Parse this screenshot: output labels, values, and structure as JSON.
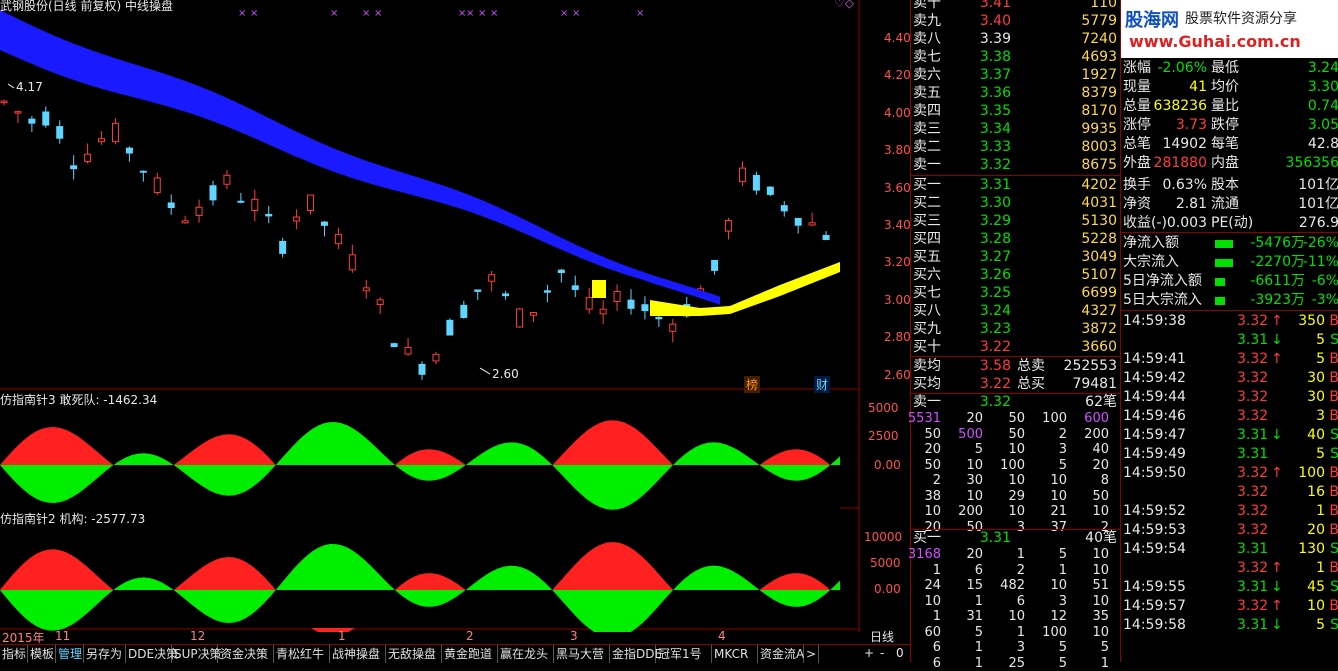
{
  "chart": {
    "title": "武钢股份(日线 前复权) 中线操盘",
    "hi_label": "4.17",
    "lo_label": "2.60",
    "price_ticks": [
      "4.40",
      "4.20",
      "4.00",
      "3.80",
      "3.60",
      "3.40",
      "3.20",
      "3.00",
      "2.80",
      "2.60"
    ],
    "markers": {
      "bang": "榜",
      "cai": "财"
    },
    "ind1_title": "仿指南针3 敢死队: -1462.34",
    "ind1_ticks": [
      "5000",
      "2500",
      "0.00"
    ],
    "ind2_title": "仿指南针2 机构: -2577.73",
    "ind2_ticks": [
      "10000",
      "5000",
      "0.00"
    ],
    "date_labels": [
      "2015年",
      "11",
      "12",
      "1",
      "2",
      "3",
      "4"
    ],
    "period_label": "日线"
  },
  "bottom_tabs": [
    "指标",
    "模板",
    "管理",
    "另存为",
    "DDE决策",
    "SUP决策",
    "资金决策",
    "青松红牛",
    "战神操盘",
    "无敌操盘",
    "黄金跑道",
    "赢在龙头",
    "黑马大营",
    "金指DDE",
    "冠军1号",
    "MKCR",
    "资金流A"
  ],
  "bottom_nav": [
    "<",
    ">",
    "+",
    "-",
    "0"
  ],
  "quote": {
    "sell": [
      {
        "label": "卖十",
        "price": "3.41",
        "vol": "110"
      },
      {
        "label": "卖九",
        "price": "3.40",
        "vol": "5779"
      },
      {
        "label": "卖八",
        "price": "3.39",
        "vol": "7240"
      },
      {
        "label": "卖七",
        "price": "3.38",
        "vol": "4693"
      },
      {
        "label": "卖六",
        "price": "3.37",
        "vol": "1927"
      },
      {
        "label": "卖五",
        "price": "3.36",
        "vol": "8379"
      },
      {
        "label": "卖四",
        "price": "3.35",
        "vol": "8170"
      },
      {
        "label": "卖三",
        "price": "3.34",
        "vol": "9935"
      },
      {
        "label": "卖二",
        "price": "3.33",
        "vol": "8003"
      },
      {
        "label": "卖一",
        "price": "3.32",
        "vol": "8675"
      }
    ],
    "buy": [
      {
        "label": "买一",
        "price": "3.31",
        "vol": "4202"
      },
      {
        "label": "买二",
        "price": "3.30",
        "vol": "4031"
      },
      {
        "label": "买三",
        "price": "3.29",
        "vol": "5130"
      },
      {
        "label": "买四",
        "price": "3.28",
        "vol": "5228"
      },
      {
        "label": "买五",
        "price": "3.27",
        "vol": "3049"
      },
      {
        "label": "买六",
        "price": "3.26",
        "vol": "5107"
      },
      {
        "label": "买七",
        "price": "3.25",
        "vol": "6699"
      },
      {
        "label": "买八",
        "price": "3.24",
        "vol": "4327"
      },
      {
        "label": "买九",
        "price": "3.23",
        "vol": "3872"
      },
      {
        "label": "买十",
        "price": "3.22",
        "vol": "3660"
      }
    ],
    "avg_sell": {
      "label": "卖均",
      "price": "3.58",
      "tlabel": "总卖",
      "total": "252553"
    },
    "avg_buy": {
      "label": "买均",
      "price": "3.22",
      "tlabel": "总买",
      "total": "79481"
    },
    "sell1_queue": {
      "label": "卖一",
      "price": "3.32",
      "count": "62笔",
      "rows": [
        [
          "5531",
          "20",
          "50",
          "100",
          "600"
        ],
        [
          "50",
          "500",
          "50",
          "2",
          "200"
        ],
        [
          "20",
          "5",
          "10",
          "3",
          "40"
        ],
        [
          "50",
          "10",
          "100",
          "5",
          "20"
        ],
        [
          "2",
          "30",
          "10",
          "10",
          "8"
        ],
        [
          "38",
          "10",
          "29",
          "10",
          "50"
        ],
        [
          "10",
          "200",
          "10",
          "21",
          "10"
        ],
        [
          "20",
          "50",
          "3",
          "37",
          "2"
        ]
      ]
    },
    "buy1_queue": {
      "label": "买一",
      "price": "3.31",
      "count": "40笔",
      "rows": [
        [
          "3168",
          "20",
          "1",
          "5",
          "10"
        ],
        [
          "1",
          "6",
          "2",
          "1",
          "10"
        ],
        [
          "24",
          "15",
          "482",
          "10",
          "51"
        ],
        [
          "10",
          "1",
          "6",
          "3",
          "10"
        ],
        [
          "1",
          "31",
          "10",
          "12",
          "35"
        ],
        [
          "60",
          "5",
          "1",
          "100",
          "10"
        ],
        [
          "6",
          "1",
          "3",
          "5",
          "5"
        ],
        [
          "6",
          "1",
          "25",
          "5",
          "1"
        ]
      ]
    }
  },
  "logo": {
    "name": "股海网",
    "slogan": "股票软件资源分享",
    "url": "www.Guhai.com.cn"
  },
  "info": {
    "rows": [
      {
        "l1": "涨幅",
        "v1": "-2.06%",
        "c1": "grn",
        "l2": "最低",
        "v2": "3.24",
        "c2": "grn"
      },
      {
        "l1": "现量",
        "v1": "41",
        "c1": "yel",
        "l2": "均价",
        "v2": "3.30",
        "c2": "grn"
      },
      {
        "l1": "总量",
        "v1": "638236",
        "c1": "yel",
        "l2": "量比",
        "v2": "0.74",
        "c2": "grn"
      },
      {
        "l1": "涨停",
        "v1": "3.73",
        "c1": "red",
        "l2": "跌停",
        "v2": "3.05",
        "c2": "grn"
      },
      {
        "l1": "总笔",
        "v1": "14902",
        "c1": "wht",
        "l2": "每笔",
        "v2": "42.8",
        "c2": "wht"
      },
      {
        "l1": "外盘",
        "v1": "281880",
        "c1": "red",
        "l2": "内盘",
        "v2": "356356",
        "c2": "grn"
      },
      {
        "l1": "换手",
        "v1": "0.63%",
        "c1": "wht",
        "l2": "股本",
        "v2": "101亿",
        "c2": "wht"
      },
      {
        "l1": "净资",
        "v1": "2.81",
        "c1": "wht",
        "l2": "流通",
        "v2": "101亿",
        "c2": "wht"
      },
      {
        "l1": "收益(-)",
        "v1": "0.003",
        "c1": "wht",
        "l2": "PE(动)",
        "v2": "276.9",
        "c2": "wht"
      }
    ],
    "flows": [
      {
        "label": "净流入额",
        "value": "-5476万",
        "pct": "-26%"
      },
      {
        "label": "大宗流入",
        "value": "-2270万",
        "pct": "-11%"
      },
      {
        "label": "5日净流入额",
        "value": "-6611万",
        "pct": "-6%"
      },
      {
        "label": "5日大宗流入",
        "value": "-3923万",
        "pct": "-3%"
      }
    ],
    "ticks": [
      {
        "t": "14:59:38",
        "p": "3.32",
        "a": "↑",
        "ac": "red",
        "v": "350",
        "f": "B",
        "fc": "red"
      },
      {
        "t": "",
        "p": "3.31",
        "a": "↓",
        "ac": "grn",
        "v": "5",
        "f": "S",
        "fc": "grn"
      },
      {
        "t": "14:59:41",
        "p": "3.32",
        "a": "↑",
        "ac": "red",
        "v": "5",
        "f": "B",
        "fc": "red"
      },
      {
        "t": "14:59:42",
        "p": "3.32",
        "a": "",
        "ac": "red",
        "v": "30",
        "f": "B",
        "fc": "red"
      },
      {
        "t": "14:59:44",
        "p": "3.32",
        "a": "",
        "ac": "red",
        "v": "30",
        "f": "B",
        "fc": "red"
      },
      {
        "t": "14:59:46",
        "p": "3.32",
        "a": "",
        "ac": "red",
        "v": "3",
        "f": "B",
        "fc": "red"
      },
      {
        "t": "14:59:47",
        "p": "3.31",
        "a": "↓",
        "ac": "grn",
        "v": "40",
        "f": "S",
        "fc": "grn"
      },
      {
        "t": "14:59:49",
        "p": "3.31",
        "a": "",
        "ac": "grn",
        "v": "5",
        "f": "S",
        "fc": "grn"
      },
      {
        "t": "14:59:50",
        "p": "3.32",
        "a": "↑",
        "ac": "red",
        "v": "100",
        "f": "B",
        "fc": "red"
      },
      {
        "t": "",
        "p": "3.32",
        "a": "",
        "ac": "red",
        "v": "16",
        "f": "B",
        "fc": "red"
      },
      {
        "t": "14:59:52",
        "p": "3.32",
        "a": "",
        "ac": "red",
        "v": "1",
        "f": "B",
        "fc": "red"
      },
      {
        "t": "14:59:53",
        "p": "3.32",
        "a": "",
        "ac": "red",
        "v": "20",
        "f": "B",
        "fc": "red"
      },
      {
        "t": "14:59:54",
        "p": "3.31",
        "a": "",
        "ac": "grn",
        "v": "130",
        "f": "S",
        "fc": "grn"
      },
      {
        "t": "",
        "p": "3.32",
        "a": "↑",
        "ac": "red",
        "v": "1",
        "f": "B",
        "fc": "red"
      },
      {
        "t": "14:59:55",
        "p": "3.31",
        "a": "↓",
        "ac": "grn",
        "v": "45",
        "f": "S",
        "fc": "grn"
      },
      {
        "t": "14:59:57",
        "p": "3.32",
        "a": "↑",
        "ac": "red",
        "v": "10",
        "f": "B",
        "fc": "red"
      },
      {
        "t": "14:59:58",
        "p": "3.31",
        "a": "↓",
        "ac": "grn",
        "v": "5",
        "f": "S",
        "fc": "grn"
      }
    ]
  }
}
